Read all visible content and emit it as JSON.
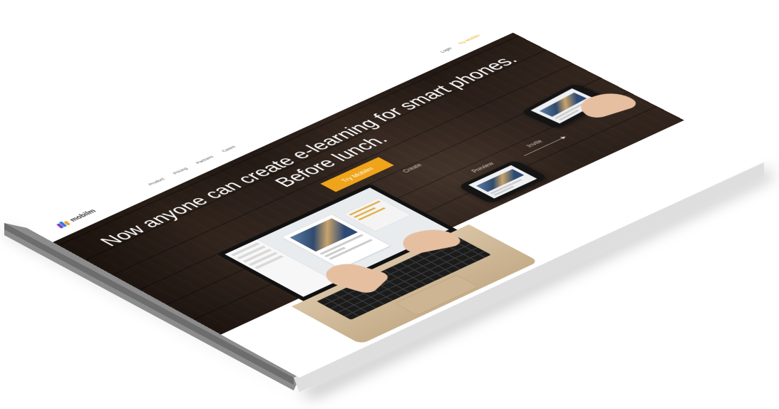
{
  "brand": {
    "name": "mobilm"
  },
  "nav": {
    "items": [
      {
        "label": "Product"
      },
      {
        "label": "Pricing"
      },
      {
        "label": "Partners"
      },
      {
        "label": "Cases"
      }
    ],
    "login_label": "Login",
    "try_label": "Try Mobilm"
  },
  "hero": {
    "headline_line1": "Now anyone can create e-learning for smart phones.",
    "headline_line2": "Before lunch.",
    "cta_label": "Try Mobilm",
    "steps": [
      {
        "label": "Create"
      },
      {
        "label": "Preview"
      },
      {
        "label": "Invite"
      }
    ]
  },
  "colors": {
    "accent": "#efa41a",
    "wood": "#3b2a20",
    "slab_edge": "#c8c8c8",
    "slab_dark": "#7a7a7a"
  }
}
